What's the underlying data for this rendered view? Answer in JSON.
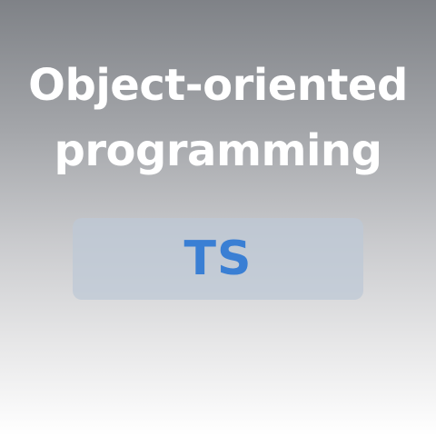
{
  "title": {
    "line1": "Object-oriented",
    "line2": "programming"
  },
  "badge": {
    "label": "TS",
    "text_color": "#3a7fd4"
  }
}
